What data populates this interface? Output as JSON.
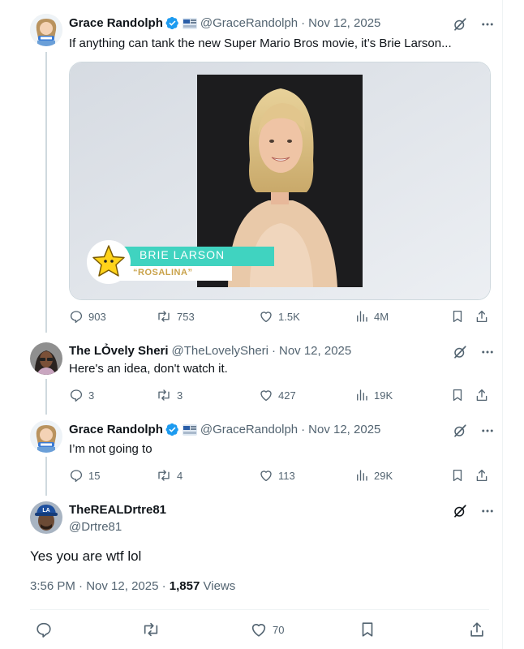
{
  "posts": [
    {
      "name": "Grace Randolph",
      "handle": "@GraceRandolph",
      "sep": "·",
      "date": "Nov 12, 2025",
      "text": "If anything can tank the new Super Mario Bros movie, it’s Brie Larson...",
      "media": {
        "name_label": "BRIE LARSON",
        "role_label": "“ROSALINA”"
      },
      "stats": {
        "replies": "903",
        "reposts": "753",
        "likes": "1.5K",
        "views": "4M"
      }
    },
    {
      "name": "The LỎvely Sheri",
      "handle": "@TheLovelySheri",
      "sep": "·",
      "date": "Nov 12, 2025",
      "text": "Here's an idea, don't watch it.",
      "stats": {
        "replies": "3",
        "reposts": "3",
        "likes": "427",
        "views": "19K"
      }
    },
    {
      "name": "Grace Randolph",
      "handle": "@GraceRandolph",
      "sep": "·",
      "date": "Nov 12, 2025",
      "text": "I’m not going to",
      "stats": {
        "replies": "15",
        "reposts": "4",
        "likes": "113",
        "views": "29K"
      }
    }
  ],
  "focus": {
    "name": "TheREALDrtre81",
    "handle": "@Drtre81",
    "text": "Yes you are wtf lol",
    "time": "3:56 PM",
    "date": "Nov 12, 2025",
    "dot": "·",
    "views_count": "1,857",
    "views_label": "Views",
    "likes": "70"
  },
  "icons": [
    "verified-badge-icon",
    "affiliate-badge-icon",
    "grok-icon",
    "more-icon",
    "reply-icon",
    "repost-icon",
    "like-icon",
    "views-icon",
    "bookmark-icon",
    "share-icon"
  ],
  "colors": {
    "accent": "#1d9bf0",
    "secondary_text": "#536471",
    "primary_text": "#0f1419",
    "border": "#eff3f4",
    "thread_line": "#cfd9de"
  }
}
